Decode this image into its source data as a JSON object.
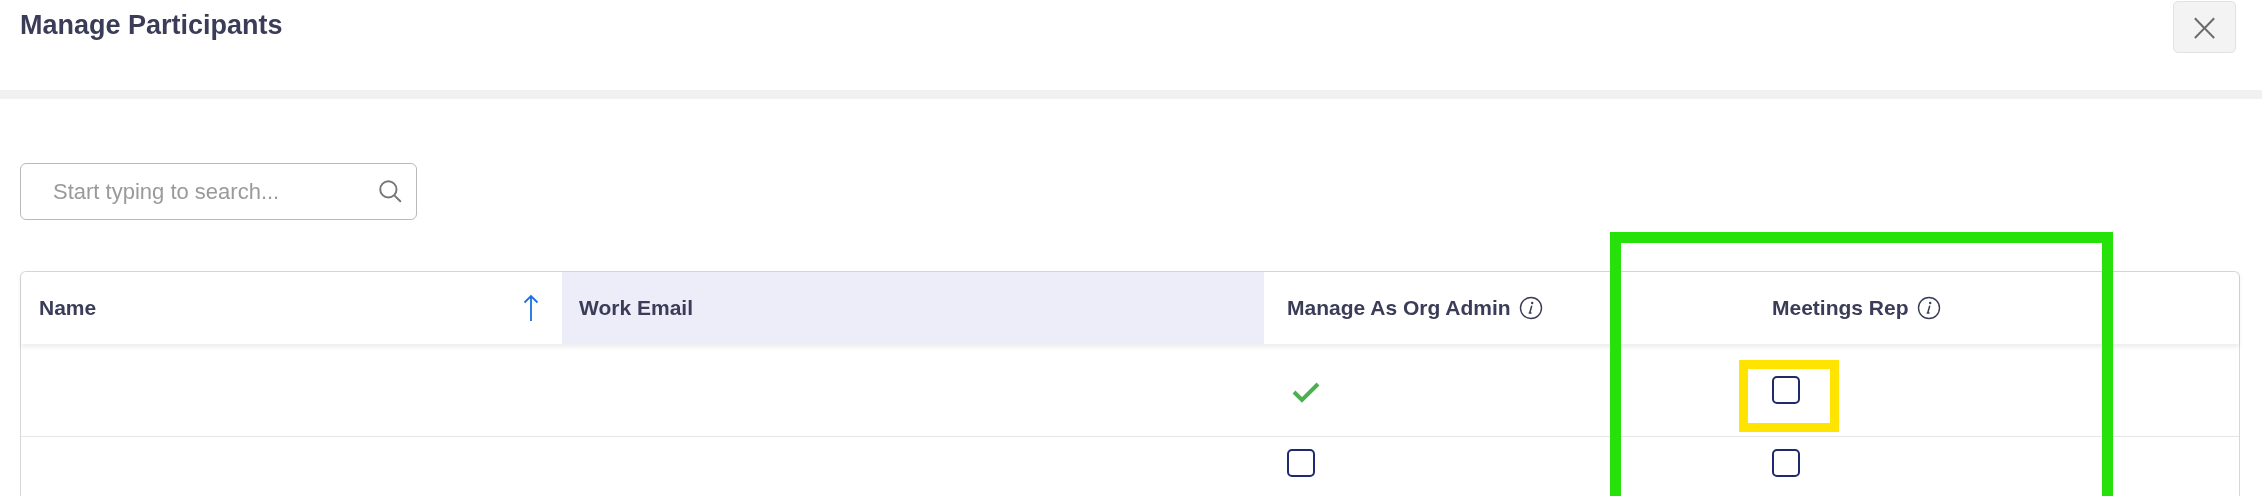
{
  "dialog": {
    "title": "Manage Participants",
    "close_label": "×"
  },
  "search": {
    "placeholder": "Start typing to search..."
  },
  "table": {
    "columns": [
      {
        "label": "Name",
        "sorted": true,
        "info": false,
        "highlighted": false
      },
      {
        "label": "Work Email",
        "sorted": false,
        "info": false,
        "highlighted": true
      },
      {
        "label": "Manage As Org Admin",
        "sorted": false,
        "info": true,
        "highlighted": false
      },
      {
        "label": "Meetings Rep",
        "sorted": false,
        "info": true,
        "highlighted": false
      }
    ],
    "rows": [
      {
        "org_admin": {
          "kind": "tick",
          "checked": true
        },
        "meetings_rep": {
          "kind": "checkbox",
          "checked": false
        }
      },
      {
        "org_admin": {
          "kind": "checkbox",
          "checked": false
        },
        "meetings_rep": {
          "kind": "checkbox",
          "checked": false
        }
      }
    ]
  },
  "annotations": [
    {
      "kind": "column",
      "color": "#26e20a"
    },
    {
      "kind": "cell",
      "color": "#ffe400"
    }
  ]
}
